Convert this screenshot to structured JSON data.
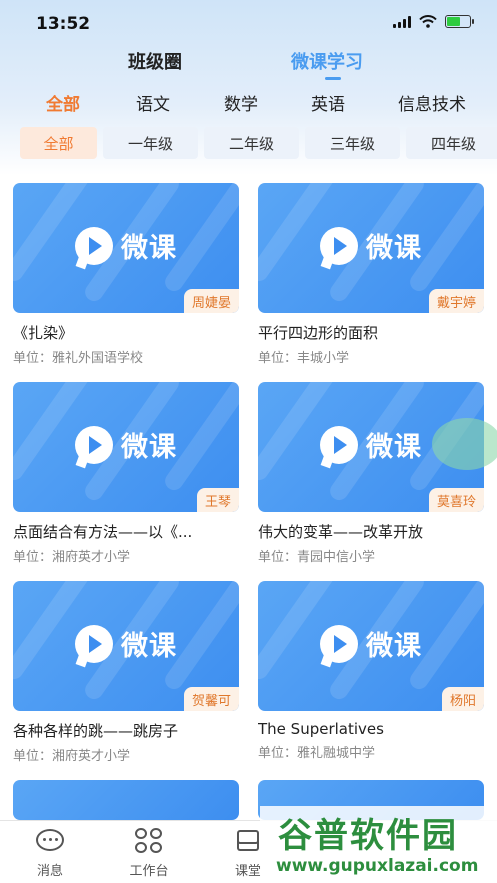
{
  "status": {
    "time": "13:52"
  },
  "main_tabs": [
    {
      "label": "班级圈"
    },
    {
      "label": "微课学习"
    }
  ],
  "subjects": [
    "全部",
    "语文",
    "数学",
    "英语",
    "信息技术"
  ],
  "grades": [
    "全部",
    "一年级",
    "二年级",
    "三年级",
    "四年级"
  ],
  "thumb_label": "微课",
  "unit_prefix": "单位：",
  "videos": [
    {
      "title": "《扎染》",
      "unit": "雅礼外国语学校",
      "teacher": "周婕晏"
    },
    {
      "title": "平行四边形的面积",
      "unit": "丰城小学",
      "teacher": "戴宇婷"
    },
    {
      "title": "点面结合有方法——以《...",
      "unit": "湘府英才小学",
      "teacher": "王琴"
    },
    {
      "title": "伟大的变革——改革开放",
      "unit": "青园中信小学",
      "teacher": "莫喜玲"
    },
    {
      "title": "各种各样的跳——跳房子",
      "unit": "湘府英才小学",
      "teacher": "贺馨可"
    },
    {
      "title": "The Superlatives",
      "unit": "雅礼融城中学",
      "teacher": "杨阳"
    }
  ],
  "bottom_nav": [
    {
      "label": "消息",
      "icon": "chat-icon"
    },
    {
      "label": "工作台",
      "icon": "grid-icon"
    },
    {
      "label": "课堂",
      "icon": "layers-icon"
    }
  ],
  "watermark": {
    "title": "谷普软件园",
    "url": "www.gupuxlazai.com"
  },
  "colors": {
    "accent": "#4a9cf0",
    "active_orange": "#f07a32",
    "thumb_blue": "#3d8ef0"
  }
}
